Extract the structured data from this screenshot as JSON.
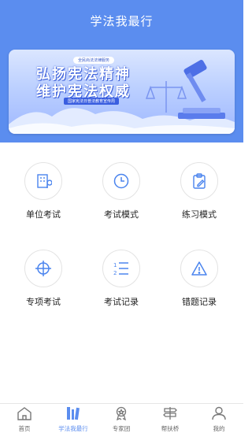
{
  "header": {
    "title": "学法我最行"
  },
  "banner": {
    "tag": "全民尚法法律服务",
    "line1": "弘扬宪法精神",
    "line2": "维护宪法权威",
    "sub": "国家宪法日普法教育宣传周"
  },
  "menu": [
    {
      "label": "单位考试",
      "icon": "building-icon"
    },
    {
      "label": "考试模式",
      "icon": "clock-icon"
    },
    {
      "label": "练习模式",
      "icon": "clipboard-edit-icon"
    },
    {
      "label": "专项考试",
      "icon": "target-icon"
    },
    {
      "label": "考试记录",
      "icon": "list-icon"
    },
    {
      "label": "错题记录",
      "icon": "warning-icon"
    }
  ],
  "tabbar": {
    "items": [
      {
        "label": "首页",
        "icon": "home-icon"
      },
      {
        "label": "学法我最行",
        "icon": "books-icon",
        "active": true
      },
      {
        "label": "专家团",
        "icon": "medal-icon"
      },
      {
        "label": "帮扶桥",
        "icon": "signpost-icon"
      },
      {
        "label": "我的",
        "icon": "user-icon"
      }
    ]
  },
  "colors": {
    "primary": "#5b8def",
    "icon_blue": "#4a84ee",
    "text": "#222222",
    "muted": "#666666"
  }
}
